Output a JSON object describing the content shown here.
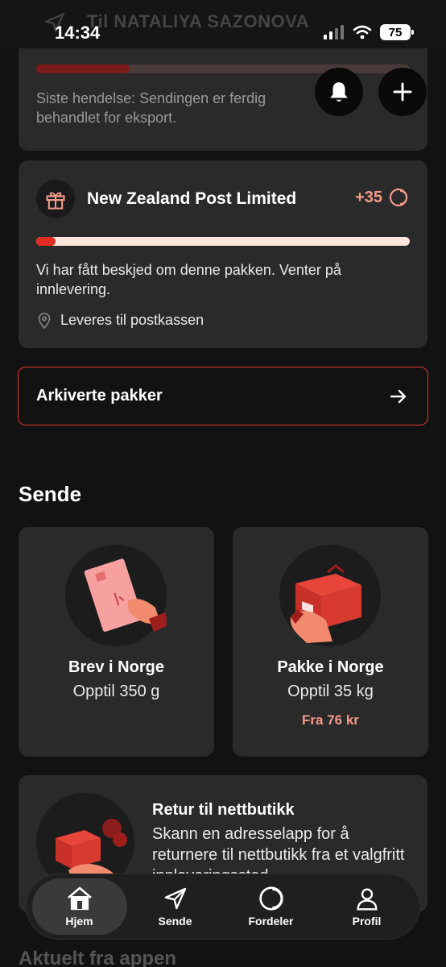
{
  "status_bar": {
    "time": "14:34",
    "battery": "75",
    "behind_title": "Til NATALIYA SAZONOVA"
  },
  "top_card": {
    "progress": 0.25,
    "message": "Siste hendelse: Sendingen er ferdig behandlet for eksport."
  },
  "nz_card": {
    "title": "New Zealand Post Limited",
    "points": "+35",
    "progress": 0.05,
    "message": "Vi har fått beskjed om denne pakken. Venter på innlevering.",
    "location": "Leveres til postkassen"
  },
  "archived": {
    "label": "Arkiverte pakker"
  },
  "send_section": {
    "title": "Sende",
    "cards": [
      {
        "title": "Brev i Norge",
        "subtitle": "Opptil 350 g",
        "price": ""
      },
      {
        "title": "Pakke i Norge",
        "subtitle": "Opptil 35 kg",
        "price": "Fra 76 kr"
      }
    ]
  },
  "retur": {
    "title": "Retur til nettbutikk",
    "body": "Skann en adresselapp for å returnere til nettbutikk fra et valgfritt innleveringssted"
  },
  "next_section": {
    "title": "Aktuelt fra appen"
  },
  "tabbar": {
    "tabs": [
      {
        "label": "Hjem",
        "icon": "home-icon",
        "active": true
      },
      {
        "label": "Sende",
        "icon": "send-icon",
        "active": false
      },
      {
        "label": "Fordeler",
        "icon": "coin-icon",
        "active": false
      },
      {
        "label": "Profil",
        "icon": "profile-icon",
        "active": false
      }
    ]
  },
  "colors": {
    "accent": "#e32d22",
    "points": "#f29a8a",
    "card": "#2a2a2a",
    "background": "#121212"
  }
}
